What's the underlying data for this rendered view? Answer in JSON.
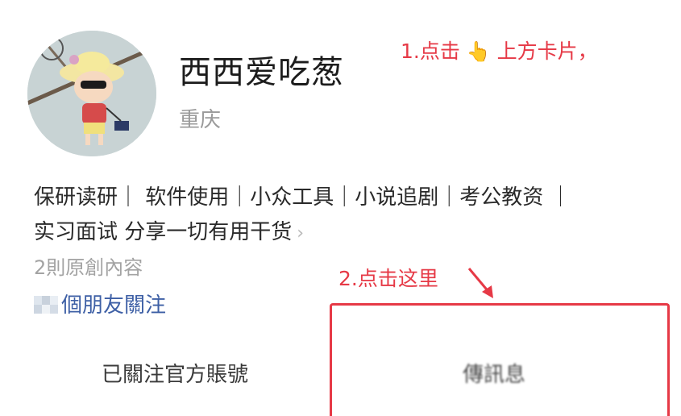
{
  "profile": {
    "name": "西西爱吃葱",
    "location": "重庆",
    "bio_line1": "保研读研｜ 软件使用｜小众工具｜小说追剧｜考公教资 ｜",
    "bio_line2": "实习面试  分享一切有用干货",
    "original_count": "2則原創內容",
    "friends_following": "個朋友關注"
  },
  "annotations": {
    "step1_prefix": "1.点击",
    "step1_suffix": "上方卡片，",
    "step2": "2.点击这里",
    "color": "#e63946"
  },
  "actions": {
    "followed_label": "已關注官方賬號",
    "message_label": "傳訊息"
  },
  "icons": {
    "avatar": "cartoon-avatar",
    "pointing_hand": "pointing-up-hand-icon",
    "chevron": "chevron-right-icon",
    "arrow": "red-arrow-icon"
  },
  "colors": {
    "link_blue": "#3d5fa5",
    "muted_text": "#9a9a9a"
  }
}
